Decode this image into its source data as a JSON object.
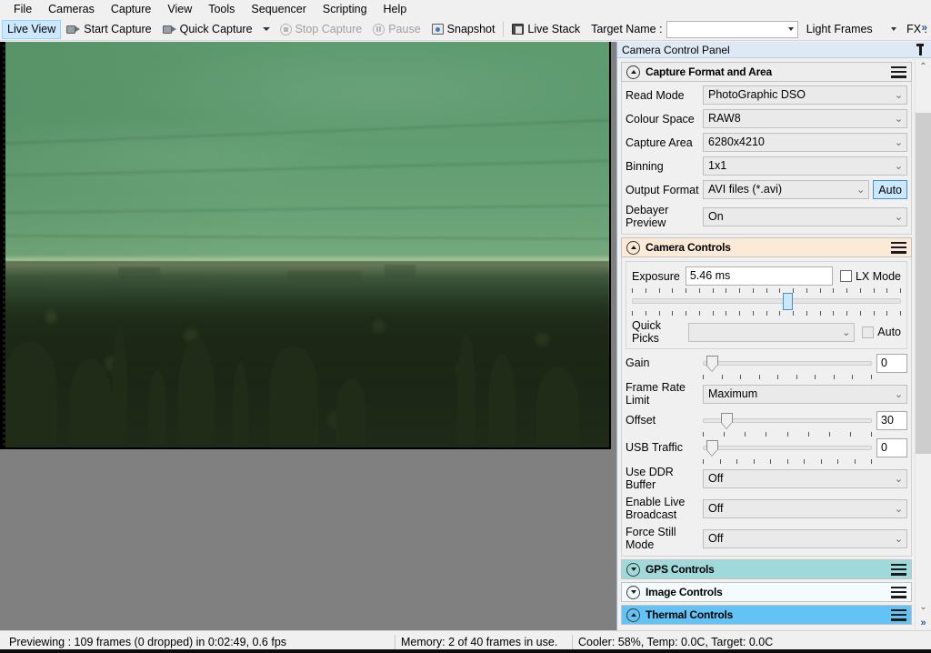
{
  "menu": {
    "items": [
      {
        "label": "File"
      },
      {
        "label": "Cameras"
      },
      {
        "label": "Capture"
      },
      {
        "label": "View"
      },
      {
        "label": "Tools"
      },
      {
        "label": "Sequencer"
      },
      {
        "label": "Scripting"
      },
      {
        "label": "Help"
      }
    ]
  },
  "toolbar": {
    "live_view": "Live View",
    "start_capture": "Start Capture",
    "quick_capture": "Quick Capture",
    "stop_capture": "Stop Capture",
    "pause": "Pause",
    "snapshot": "Snapshot",
    "live_stack": "Live Stack",
    "target_name_label": "Target Name :",
    "target_name_value": "",
    "frame_type_value": "Light Frames",
    "fx_label": "FX :",
    "overflow_chevrons": "»"
  },
  "panel": {
    "title": "Camera Control Panel",
    "pin_icon": "pin-icon",
    "groups": [
      {
        "id": "capture_format",
        "title": "Capture Format and Area",
        "expanded": true,
        "style": "plain",
        "rows": [
          {
            "label": "Read Mode",
            "value": "PhotoGraphic DSO"
          },
          {
            "label": "Colour Space",
            "value": "RAW8"
          },
          {
            "label": "Capture Area",
            "value": "6280x4210"
          },
          {
            "label": "Binning",
            "value": "1x1"
          },
          {
            "label": "Output Format",
            "value": "AVI files (*.avi)",
            "button": "Auto"
          },
          {
            "label": "Debayer Preview",
            "value": "On"
          }
        ]
      },
      {
        "id": "camera_controls",
        "title": "Camera Controls",
        "expanded": true,
        "style": "peach",
        "exposure": {
          "label": "Exposure",
          "value": "5.46 ms",
          "lx_mode_label": "LX Mode",
          "lx_mode_checked": false,
          "slider_percent": 56,
          "quick_picks_label": "Quick Picks",
          "quick_picks_value": "",
          "auto_label": "Auto",
          "auto_checked": false
        },
        "gain": {
          "label": "Gain",
          "value": "0",
          "slider_percent": 2
        },
        "frame_rate": {
          "label": "Frame Rate Limit",
          "value": "Maximum"
        },
        "offset": {
          "label": "Offset",
          "value": "30",
          "slider_percent": 11
        },
        "usb": {
          "label": "USB Traffic",
          "value": "0",
          "slider_percent": 2
        },
        "rows": [
          {
            "label": "Use DDR Buffer",
            "value": "Off"
          },
          {
            "label": "Enable Live Broadcast",
            "value": "Off"
          },
          {
            "label": "Force Still Mode",
            "value": "Off"
          }
        ]
      },
      {
        "id": "gps_controls",
        "title": "GPS Controls",
        "expanded": false,
        "style": "teal"
      },
      {
        "id": "image_controls",
        "title": "Image Controls",
        "expanded": false,
        "style": "white"
      },
      {
        "id": "thermal_controls",
        "title": "Thermal Controls",
        "expanded": true,
        "style": "blue"
      }
    ]
  },
  "statusbar": {
    "preview": "Previewing : 109 frames (0 dropped) in 0:02:49, 0.6 fps",
    "memory": "Memory: 2 of 40 frames in use.",
    "cooler": "Cooler: 58%, Temp: 0.0C, Target: 0.0C",
    "chevrons": "»"
  },
  "colors": {
    "accent_blue": "#cce8ff",
    "header_peach": "#fbead8",
    "header_teal": "#9fd9d9",
    "header_blue": "#64c3f5",
    "panel_title_bg": "#ddeaf6"
  }
}
